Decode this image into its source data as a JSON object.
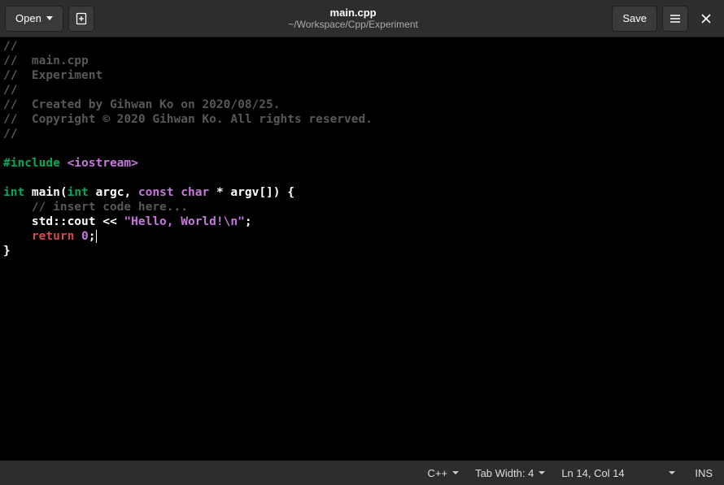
{
  "header": {
    "open_label": "Open",
    "save_label": "Save",
    "title": "main.cpp",
    "subtitle": "~/Workspace/Cpp/Experiment"
  },
  "code": {
    "l1": "//",
    "l2_a": "//  ",
    "l2_b": "main.cpp",
    "l3_a": "//  ",
    "l3_b": "Experiment",
    "l4": "//",
    "l5_a": "//  ",
    "l5_b": "Created by Gihwan Ko on 2020/08/25.",
    "l6_a": "//  ",
    "l6_b": "Copyright © 2020 Gihwan Ko. All rights reserved.",
    "l7": "//",
    "l8": "",
    "l9_a": "#include",
    "l9_b": " ",
    "l9_c": "<iostream>",
    "l10": "",
    "l11_a": "int",
    "l11_b": " main(",
    "l11_c": "int",
    "l11_d": " argc, ",
    "l11_e": "const",
    "l11_f": " ",
    "l11_g": "char",
    "l11_h": " * argv[]) {",
    "l12_a": "    ",
    "l12_b": "// insert code here...",
    "l13_a": "    std::cout << ",
    "l13_b": "\"Hello, World!",
    "l13_c": "\\n",
    "l13_d": "\"",
    "l13_e": ";",
    "l14_a": "    ",
    "l14_b": "return",
    "l14_c": " ",
    "l14_d": "0",
    "l14_e": ";",
    "l15": "}"
  },
  "status": {
    "language": "C++",
    "tab_width": "Tab Width: 4",
    "position": "Ln 14, Col 14",
    "insert_mode": "INS"
  }
}
